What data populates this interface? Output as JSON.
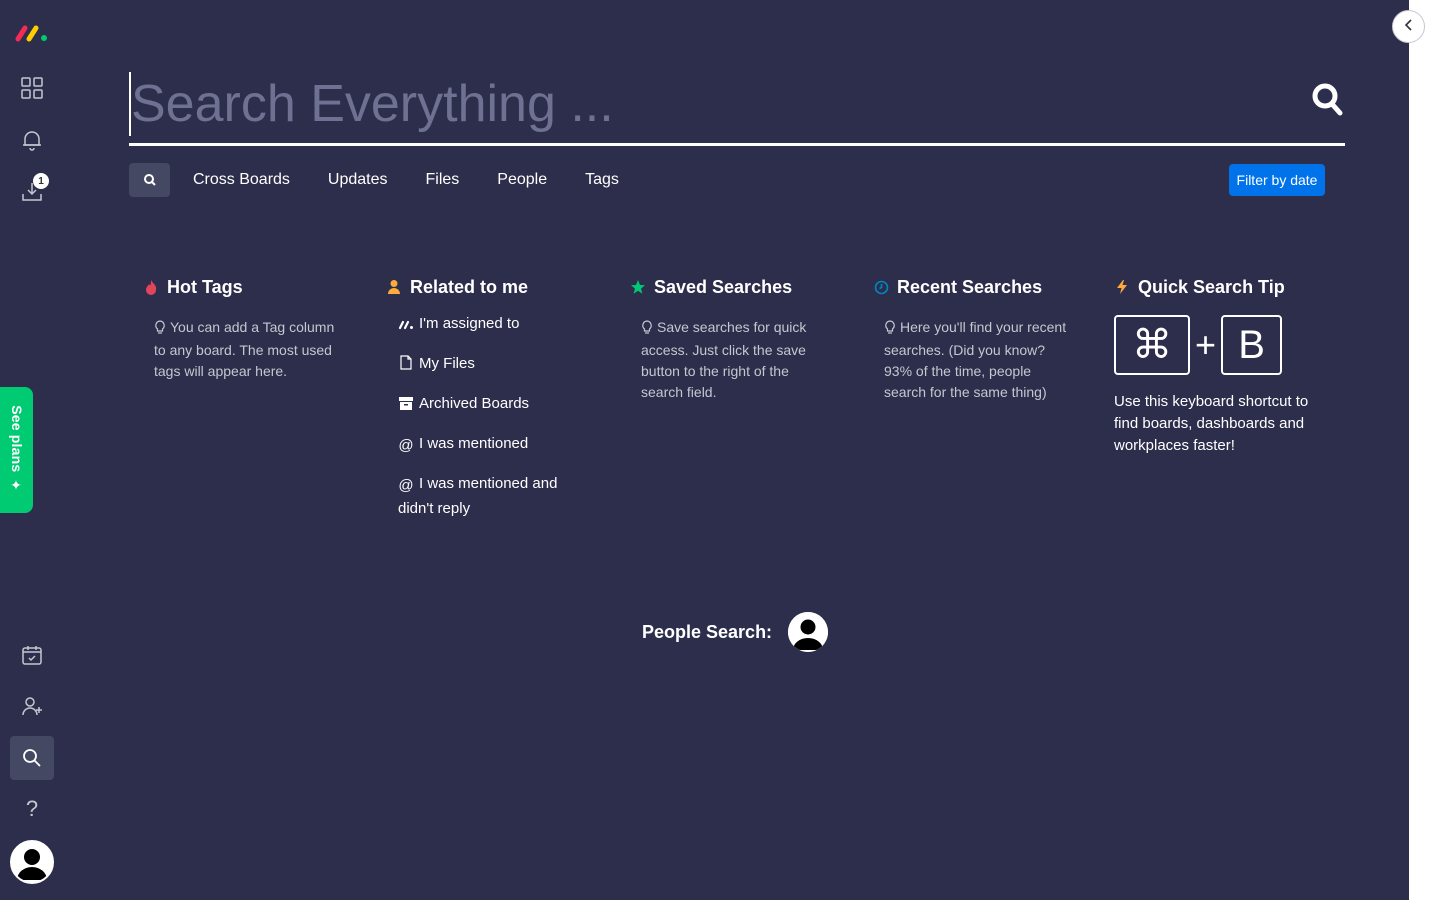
{
  "search": {
    "placeholder": "Search Everything ..."
  },
  "tabs": [
    {
      "label": "Cross Boards"
    },
    {
      "label": "Updates"
    },
    {
      "label": "Files"
    },
    {
      "label": "People"
    },
    {
      "label": "Tags"
    }
  ],
  "filter_button": "Filter by date",
  "rail": {
    "notifications_badge": "1",
    "see_plans": "See plans"
  },
  "columns": {
    "hot_tags": {
      "title": "Hot Tags",
      "tip": "You can add a Tag column to any board. The most used tags will appear here."
    },
    "related": {
      "title": "Related to me",
      "items": [
        {
          "label": "I'm assigned to",
          "icon": "monday-logo-icon"
        },
        {
          "label": "My Files",
          "icon": "file-icon"
        },
        {
          "label": "Archived Boards",
          "icon": "archive-icon"
        },
        {
          "label": "I was mentioned",
          "icon": "at-icon"
        },
        {
          "label": "I was mentioned and didn't reply",
          "icon": "at-icon"
        }
      ]
    },
    "saved": {
      "title": "Saved Searches",
      "tip": "Save searches for quick access. Just click the save button to the right of the search field."
    },
    "recent": {
      "title": "Recent Searches",
      "tip": "Here you'll find your recent searches. (Did you know? 93% of the time, people search for the same thing)"
    },
    "quick_tip": {
      "title": "Quick Search Tip",
      "key1": "⌘",
      "plus": "+",
      "key2": "B",
      "description": "Use this keyboard shortcut to find boards, dashboards and workplaces faster!"
    }
  },
  "people_search": {
    "label": "People Search:"
  },
  "colors": {
    "background": "#2c2e4b",
    "accent_blue": "#0073ea",
    "see_plans_green": "#00ca72",
    "hot_red": "#e2445c",
    "related_orange": "#fdab3d",
    "saved_green": "#00c875",
    "recent_blue": "#0086c0",
    "tip_orange": "#fdab3d"
  }
}
